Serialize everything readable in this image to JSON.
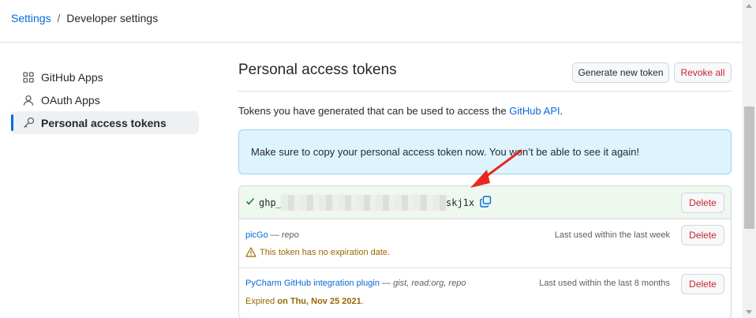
{
  "breadcrumb": {
    "settings": "Settings",
    "separator": "/",
    "current": "Developer settings"
  },
  "sidebar": {
    "items": [
      {
        "label": "GitHub Apps",
        "icon": "apps-grid-icon",
        "active": false
      },
      {
        "label": "OAuth Apps",
        "icon": "person-icon",
        "active": false
      },
      {
        "label": "Personal access tokens",
        "icon": "key-icon",
        "active": true
      }
    ]
  },
  "main": {
    "title": "Personal access tokens",
    "generate_label": "Generate new token",
    "revoke_label": "Revoke all",
    "description_prefix": "Tokens you have generated that can be used to access the ",
    "description_link": "GitHub API",
    "description_suffix": ".",
    "flash_message": "Make sure to copy your personal access token now. You won’t be able to see it again!"
  },
  "new_token": {
    "prefix": "ghp_",
    "suffix": "skj1x",
    "delete_label": "Delete",
    "redacted": true
  },
  "tokens": [
    {
      "name": "picGo",
      "separator": "—",
      "scopes": "repo",
      "last_used": "Last used within the last week",
      "warning": "This token has no expiration date.",
      "delete_label": "Delete"
    },
    {
      "name": "PyCharm GitHub integration plugin",
      "separator": "—",
      "scopes": "gist, read:org, repo",
      "last_used": "Last used within the last 8 months",
      "expired_prefix": "Expired ",
      "expired_date": "on Thu, Nov 25 2021",
      "expired_suffix": ".",
      "delete_label": "Delete"
    }
  ],
  "colors": {
    "link": "#0969da",
    "danger": "#cf222e",
    "attention": "#9a6700",
    "success": "#1a7f37",
    "flash_bg": "#ddf4ff",
    "annotation_arrow": "#e8281f"
  }
}
